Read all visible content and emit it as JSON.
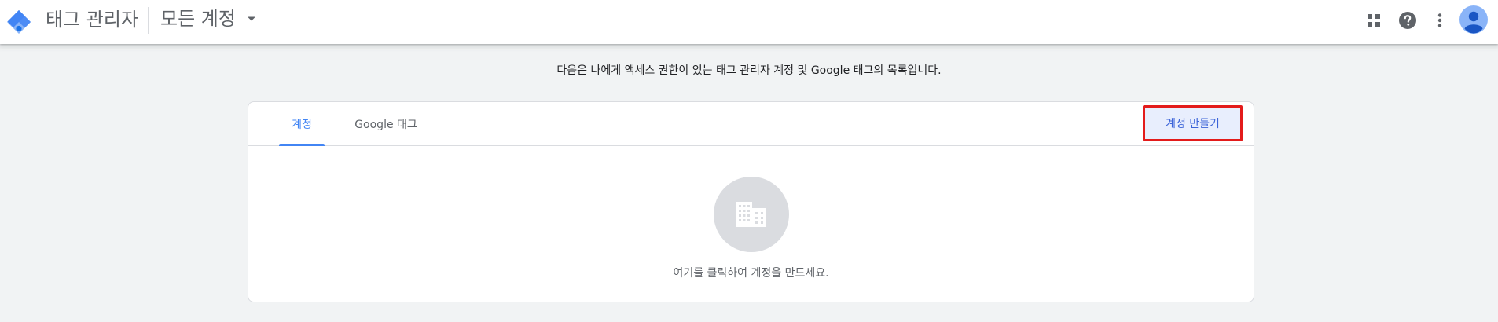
{
  "header": {
    "app_name": "태그 관리자",
    "account_selector": "모든 계정",
    "icons": [
      "tag-manager-logo",
      "apps-icon",
      "help-icon",
      "more-vert-icon",
      "account-avatar"
    ]
  },
  "intro_text": "다음은 나에게 액세스 권한이 있는 태그 관리자 계정 및 Google 태그의 목록입니다.",
  "tabs": [
    {
      "label": "계정",
      "active": true
    },
    {
      "label": "Google 태그",
      "active": false
    }
  ],
  "create_account_button": "계정 만들기",
  "empty_state": {
    "icon": "building-icon",
    "text": "여기를 클릭하여 계정을 만드세요."
  },
  "colors": {
    "accent": "#4285f4",
    "highlight_border": "#e31b1b",
    "create_button_bg": "#e8eefd"
  }
}
